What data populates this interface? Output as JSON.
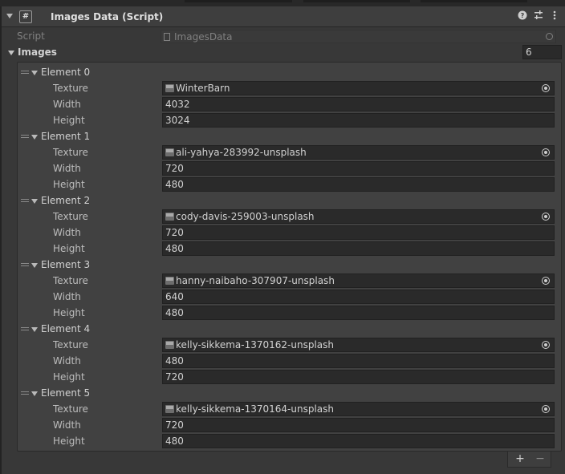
{
  "component": {
    "title": "Images Data (Script)"
  },
  "script_row": {
    "label": "Script",
    "value": "ImagesData"
  },
  "images": {
    "label": "Images",
    "count": "6"
  },
  "labels": {
    "texture": "Texture",
    "width": "Width",
    "height": "Height"
  },
  "elements": [
    {
      "name": "Element 0",
      "texture": "WinterBarn",
      "width": "4032",
      "height": "3024"
    },
    {
      "name": "Element 1",
      "texture": "ali-yahya-283992-unsplash",
      "width": "720",
      "height": "480"
    },
    {
      "name": "Element 2",
      "texture": "cody-davis-259003-unsplash",
      "width": "720",
      "height": "480"
    },
    {
      "name": "Element 3",
      "texture": "hanny-naibaho-307907-unsplash",
      "width": "640",
      "height": "480"
    },
    {
      "name": "Element 4",
      "texture": "kelly-sikkema-1370162-unsplash",
      "width": "480",
      "height": "720"
    },
    {
      "name": "Element 5",
      "texture": "kelly-sikkema-1370164-unsplash",
      "width": "720",
      "height": "480"
    }
  ],
  "footer": {
    "add": "+",
    "remove": "−"
  },
  "icons": {
    "help": "help-icon",
    "presets": "presets-icon",
    "menu": "kebab-menu-icon"
  },
  "colors": {
    "background": "#383838",
    "field": "#2a2a2a",
    "list_box": "#414141"
  }
}
